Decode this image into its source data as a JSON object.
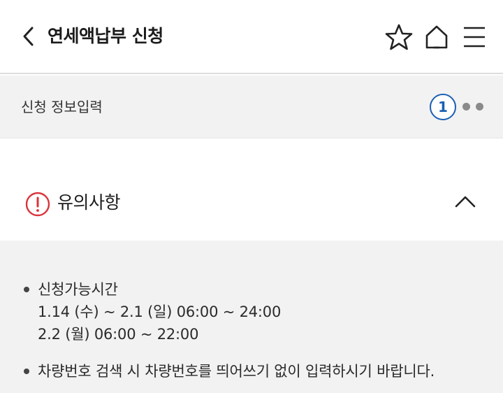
{
  "header": {
    "title": "연세액납부 신청",
    "back_icon": "chevron-left-icon",
    "star_icon": "star-icon",
    "home_icon": "home-icon",
    "menu_icon": "hamburger-menu-icon"
  },
  "steps": {
    "label": "신청 정보입력",
    "current": "1",
    "total_steps": 3
  },
  "notice": {
    "title": "유의사항",
    "icon": "exclamation-circle-icon",
    "toggle_icon": "chevron-up-icon",
    "items": [
      {
        "title": "신청가능시간",
        "lines": [
          "1.14 (수) ~ 2.1 (일) 06:00 ~ 24:00",
          "2.2 (월) 06:00 ~ 22:00"
        ]
      },
      {
        "title": "차량번호 검색 시 차량번호를 띄어쓰기 없이 입력하시기 바랍니다."
      }
    ]
  },
  "colors": {
    "accent_blue": "#1a5fb4",
    "warning_red": "#d9343a",
    "panel_gray": "#f2f2f2"
  }
}
